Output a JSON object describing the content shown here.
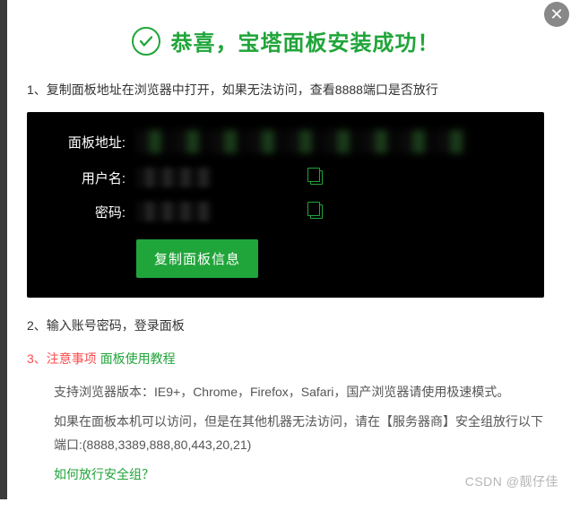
{
  "header": {
    "title": "恭喜，宝塔面板安装成功！"
  },
  "step1": {
    "text": "1、复制面板地址在浏览器中打开，如果无法访问，查看8888端口是否放行"
  },
  "panel": {
    "address_label": "面板地址:",
    "address_value": "[已隐藏]",
    "username_label": "用户名:",
    "username_value": "[已隐藏]",
    "password_label": "密码:",
    "password_value": "[已隐藏]",
    "copy_button": "复制面板信息"
  },
  "step2": {
    "text": "2、输入账号密码，登录面板"
  },
  "step3": {
    "prefix": "3、注意事项",
    "link": "面板使用教程"
  },
  "notes": {
    "browser_support": "支持浏览器版本：IE9+，Chrome，Firefox，Safari，国产浏览器请使用极速模式。",
    "firewall_note": "如果在面板本机可以访问，但是在其他机器无法访问，请在【服务器商】安全组放行以下端口:(8888,3389,888,80,443,20,21)",
    "security_group_link": "如何放行安全组？"
  },
  "watermark": "CSDN @靓仔佳"
}
